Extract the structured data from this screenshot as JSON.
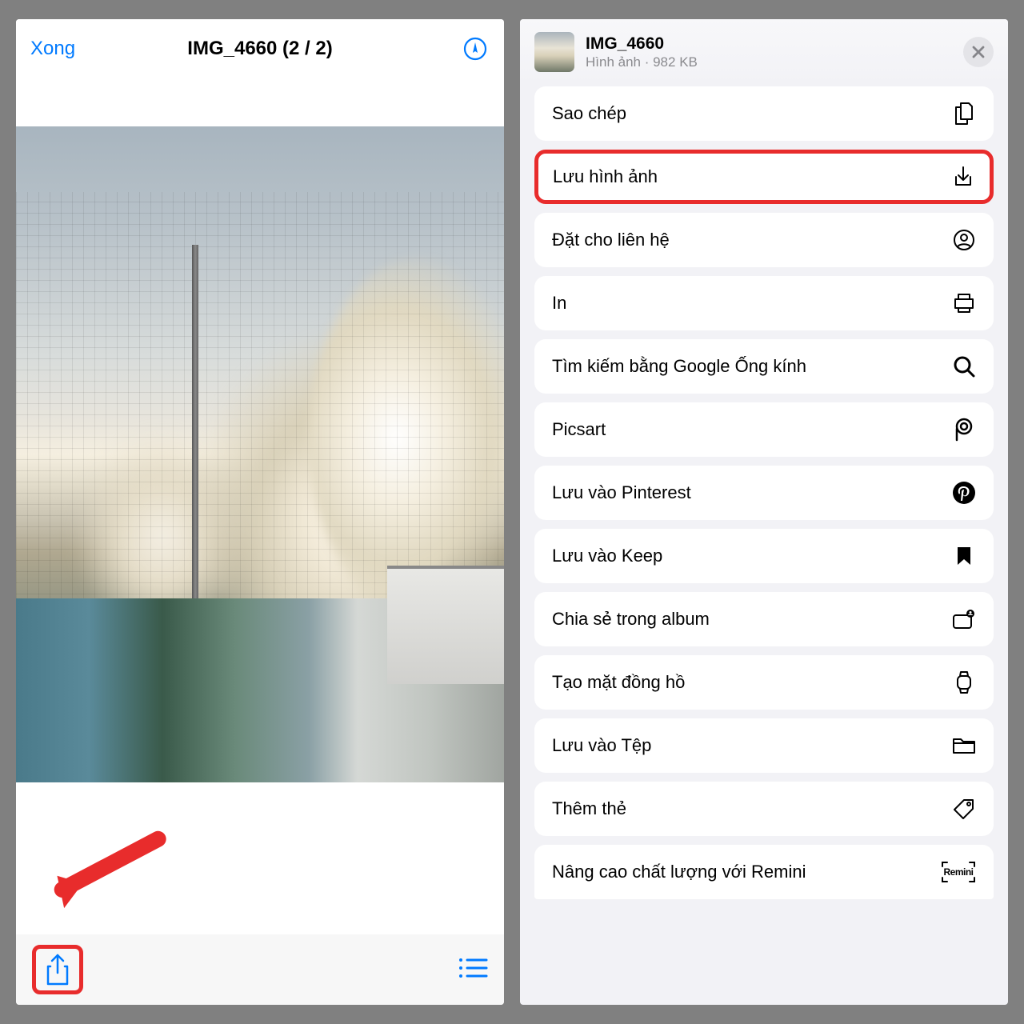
{
  "left": {
    "done": "Xong",
    "title": "IMG_4660 (2 / 2)"
  },
  "sheet": {
    "title": "IMG_4660",
    "subtitle": "Hình ảnh · 982 KB"
  },
  "menu": {
    "copy": "Sao chép",
    "save_image": "Lưu hình ảnh",
    "assign_contact": "Đặt cho liên hệ",
    "print": "In",
    "google_lens": "Tìm kiếm bằng Google Ống kính",
    "picsart": "Picsart",
    "pinterest": "Lưu vào Pinterest",
    "keep": "Lưu vào Keep",
    "share_album": "Chia sẻ trong album",
    "watch_face": "Tạo mặt đồng hồ",
    "save_files": "Lưu vào Tệp",
    "add_tags": "Thêm thẻ",
    "remini": "Nâng cao chất lượng với Remini",
    "remini_label": "Remini"
  }
}
